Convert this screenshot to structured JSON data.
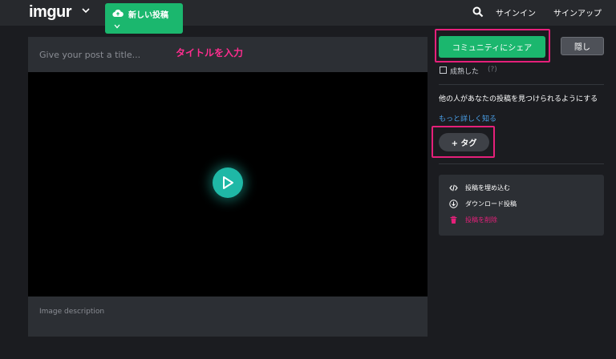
{
  "header": {
    "logo": "imgur",
    "new_post_label": "新しい投稿",
    "signin": "サインイン",
    "signup": "サインアップ"
  },
  "editor": {
    "title_placeholder": "Give your post a title...",
    "annotation": "タイトルを入力",
    "description_placeholder": "Image description"
  },
  "sidebar": {
    "share_label": "コミュニティにシェア",
    "hide_label": "隠し",
    "mature_label": "成熟した",
    "mature_help": "(?)",
    "tag_description": "他の人があなたの投稿を見つけられるようにする",
    "learn_more": "もっと詳しく知る",
    "tag_label": "+ タグ",
    "actions": [
      {
        "label": "投稿を埋め込む",
        "icon": "embed-code-icon"
      },
      {
        "label": "ダウンロード投稿",
        "icon": "download-icon"
      },
      {
        "label": "投稿を削除",
        "icon": "trash-icon"
      }
    ]
  },
  "colors": {
    "accent_green": "#1bb76e",
    "highlight_pink": "#e5207a",
    "play_teal": "#1fb8a6"
  }
}
